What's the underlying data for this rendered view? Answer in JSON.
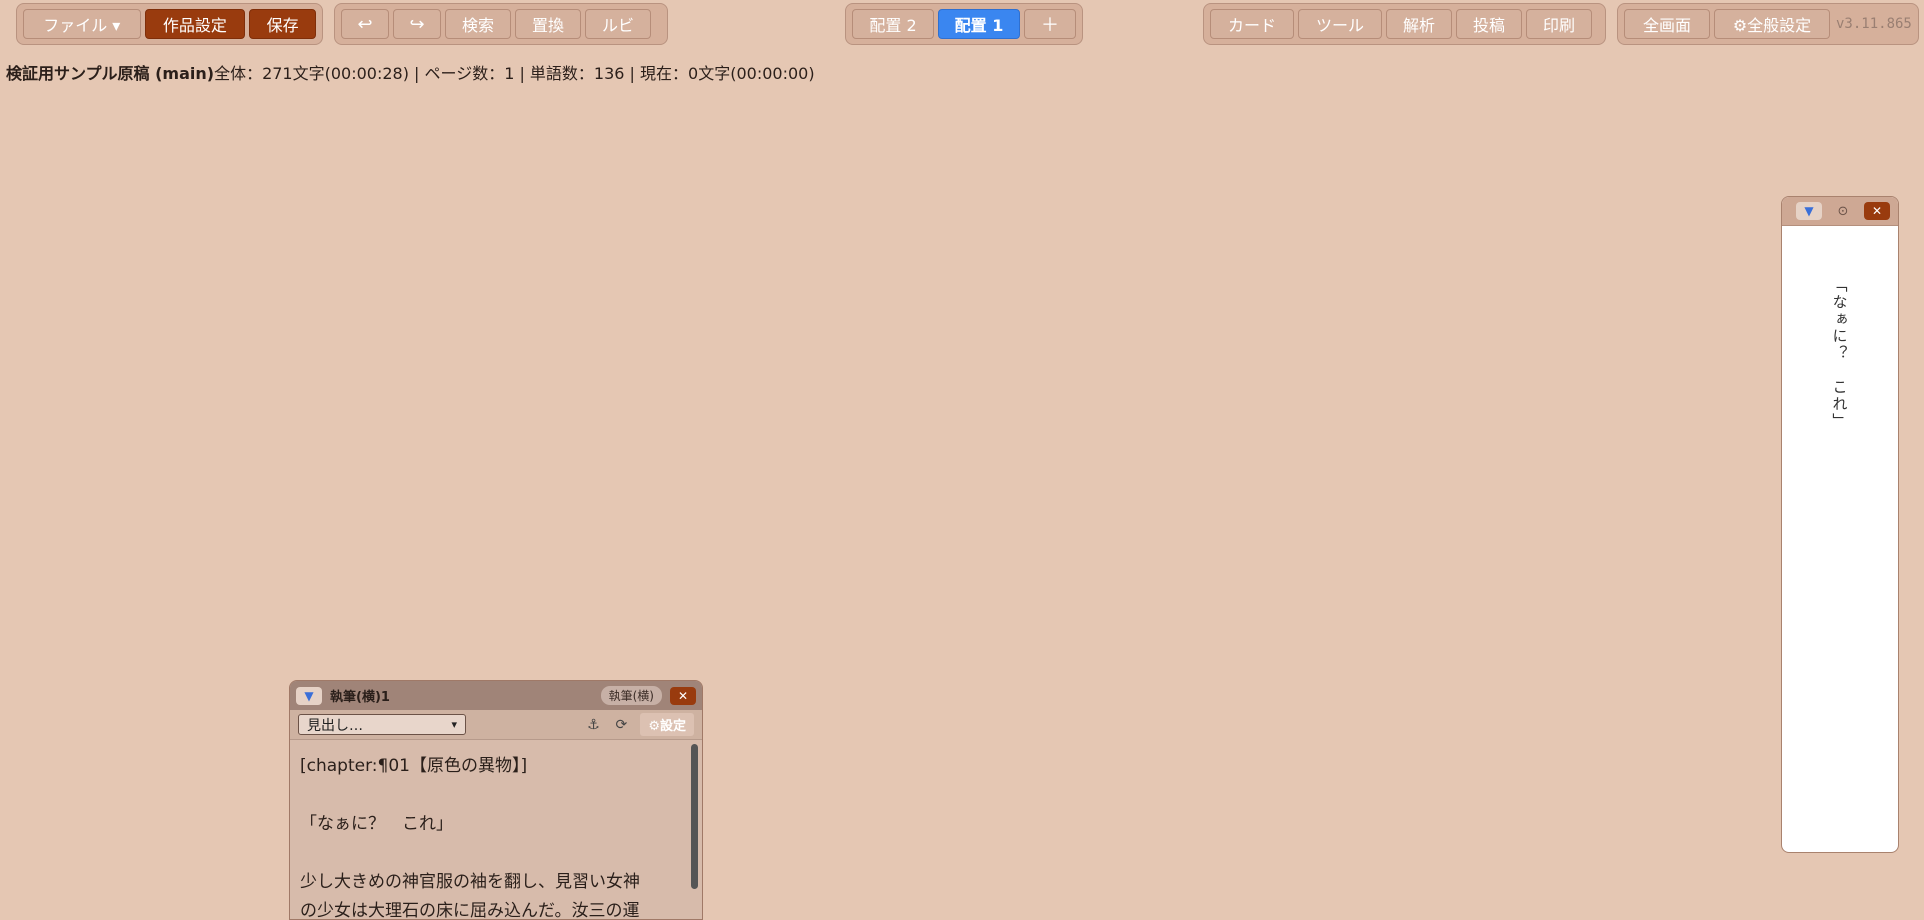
{
  "toolbar": {
    "file_label": "ファイル ▾",
    "work_settings_label": "作品設定",
    "save_label": "保存",
    "undo_icon": "undo-icon",
    "undo_glyph": "↩",
    "redo_icon": "redo-icon",
    "redo_glyph": "↪",
    "search_label": "検索",
    "replace_label": "置換",
    "ruby_label": "ルビ",
    "layout2_label": "配置 2",
    "layout1_label": "配置 1",
    "add_label": "＋",
    "card_label": "カード",
    "tools_label": "ツール",
    "analysis_label": "解析",
    "post_label": "投稿",
    "print_label": "印刷",
    "fullscreen_label": "全画面",
    "general_settings_label": "⚙全般設定",
    "version": "v3.11.865"
  },
  "status": {
    "title": "検証用サンプル原稿 (main)",
    "stats": "全体：271文字(00:00:28) | ページ数：1 | 単語数：136 | 現在：0文字(00:00:00)"
  },
  "preview": {
    "text": "「なぁに？　これ」",
    "collapse_glyph": "▼",
    "dot_glyph": "⊙",
    "close_glyph": "✕"
  },
  "editor": {
    "title": "執筆(横)1",
    "mode_badge": "執筆(横)",
    "collapse_glyph": "▼",
    "close_glyph": "✕",
    "heading_select": "見出し…",
    "anchor_glyph": "⚓",
    "refresh_glyph": "⟳",
    "settings_label": "⚙設定",
    "lines": [
      "[chapter:¶01【原色の異物】]",
      "",
      "「なぁに？　これ」",
      "",
      "少し大きめの神官服の袖を翻し、見習い女神",
      "の少女は大理石の床に屈み込んだ。汝三の運"
    ]
  },
  "colors": {
    "background": "#e5c7b3",
    "accent_dark": "#993b0e",
    "accent_blue": "#3a86f0"
  }
}
